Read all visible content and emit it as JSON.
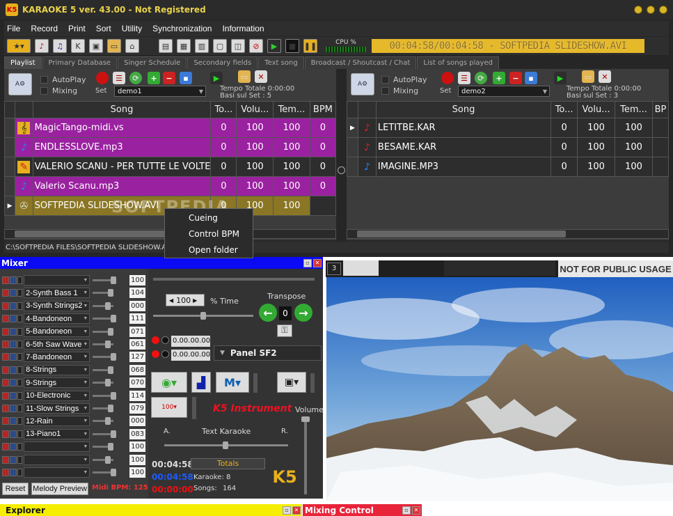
{
  "app": {
    "title": "KARAOKE 5   ver. 43.00 - Not Registered",
    "logo": "K5"
  },
  "menu": [
    "File",
    "Record",
    "Print",
    "Sort",
    "Utility",
    "Synchronization",
    "Information"
  ],
  "toolbar": {
    "cpu_label": "CPU %",
    "marquee": "00:04:58/00:04:58 - SOFTPEDIA SLIDESHOW.AVI"
  },
  "tabs": [
    "Playlist",
    "Primary Database",
    "Singer Schedule",
    "Secondary fields",
    "Text song",
    "Broadcast / Shoutcast / Chat",
    "List of songs played"
  ],
  "left": {
    "autoplay": "AutoPlay",
    "mixing": "Mixing",
    "set_label": "Set",
    "set_value": "demo1",
    "tempo": "Tempo Totale  0:00:00",
    "basi": "Basi sul Set : 5",
    "columns": [
      "Song",
      "To...",
      "Volu...",
      "Tem...",
      "BPM"
    ],
    "rows": [
      {
        "name": "MagicTango-midi.vs",
        "to": "0",
        "vol": "100",
        "tem": "100",
        "bpm": "0"
      },
      {
        "name": "ENDLESSLOVE.mp3",
        "to": "0",
        "vol": "100",
        "tem": "100",
        "bpm": "0"
      },
      {
        "name": "VALERIO SCANU - PER TUTTE LE VOLTE",
        "to": "0",
        "vol": "100",
        "tem": "100",
        "bpm": "0"
      },
      {
        "name": "Valerio Scanu.mp3",
        "to": "0",
        "vol": "100",
        "tem": "100",
        "bpm": "0"
      },
      {
        "name": "SOFTPEDIA SLIDESHOW.AVI",
        "to": "0",
        "vol": "100",
        "tem": "100",
        "bpm": ""
      }
    ]
  },
  "right": {
    "autoplay": "AutoPlay",
    "mixing": "Mixing",
    "set_label": "Set",
    "set_value": "demo2",
    "tempo": "Tempo Totale  0:00:00",
    "basi": "Basi sul Set : 3",
    "columns": [
      "Song",
      "To...",
      "Volu...",
      "Tem...",
      "BP"
    ],
    "rows": [
      {
        "name": "LETITBE.KAR",
        "to": "0",
        "vol": "100",
        "tem": "100"
      },
      {
        "name": "BESAME.KAR",
        "to": "0",
        "vol": "100",
        "tem": "100"
      },
      {
        "name": "IMAGINE.MP3",
        "to": "0",
        "vol": "100",
        "tem": "100"
      }
    ]
  },
  "path": "C:\\SOFTPEDIA FILES\\SOFTPEDIA SLIDESHOW.AVI",
  "watermark": "SOFTPEDIA",
  "context_menu": [
    "Cueing",
    "Control BPM",
    "Open folder"
  ],
  "mixer": {
    "title": "Mixer",
    "channels": [
      {
        "name": "",
        "value": "100"
      },
      {
        "name": "2-Synth Bass 1",
        "value": "104"
      },
      {
        "name": "3-Synth Strings2",
        "value": "000"
      },
      {
        "name": "4-Bandoneon",
        "value": "111"
      },
      {
        "name": "5-Bandoneon",
        "value": "071"
      },
      {
        "name": "6-5th Saw Wave",
        "value": "061"
      },
      {
        "name": "7-Bandoneon",
        "value": "127"
      },
      {
        "name": "8-Strings",
        "value": "068"
      },
      {
        "name": "9-Strings",
        "value": "070"
      },
      {
        "name": "10-Electronic",
        "value": "114"
      },
      {
        "name": "11-Slow Strings",
        "value": "079"
      },
      {
        "name": "12-Rain",
        "value": "000"
      },
      {
        "name": "13-Piano1",
        "value": "083"
      },
      {
        "name": "",
        "value": "100"
      },
      {
        "name": "",
        "value": "100"
      },
      {
        "name": "",
        "value": "100"
      }
    ],
    "reset": "Reset",
    "melody_preview": "Melody Preview",
    "midi_bpm": "Midi BPM: 125",
    "time_value": "100",
    "time_label": "% Time",
    "transpose_label": "Transpose",
    "transpose_value": "0",
    "time_a": "0.00.00.00",
    "time_b": "0.00.00.00",
    "panel": "Panel SF2",
    "instrument": "K5 Instrument",
    "a_label": "A.",
    "r_label": "R.",
    "text_karaoke": "Text Karaoke",
    "volume": "Volume",
    "clock1": "00:04:58",
    "clock2": "00:04:58",
    "clock3": "00:00:00",
    "totals": "Totals",
    "karaoke_count": "Karaoke: 8",
    "songs_label": "Songs:",
    "songs_count": "164",
    "gauge": "100"
  },
  "video": {
    "not_public": "NOT FOR PUBLIC USAGE",
    "selector": "3"
  },
  "explorer": "Explorer",
  "mixing_control": "Mixing Control",
  "colors": {
    "accent": "#9a22a0",
    "mixer_title": "#0a0af5",
    "explorer": "#f5ee00",
    "mixing_control": "#e8243a"
  }
}
